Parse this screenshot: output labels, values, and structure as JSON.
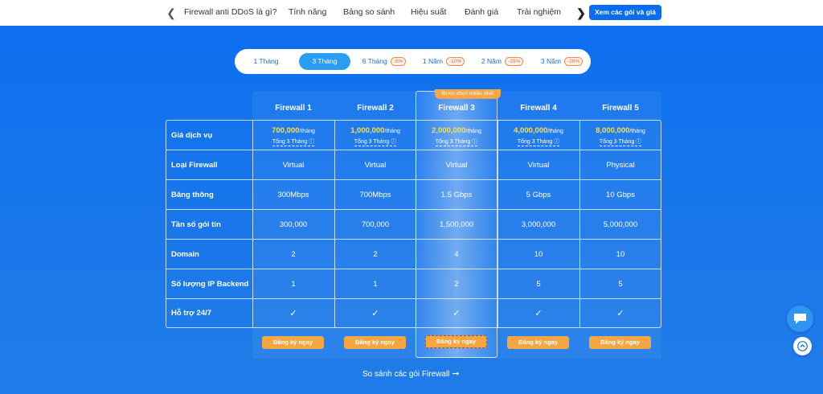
{
  "nav": {
    "items": [
      "Firewall anti DDoS là gì?",
      "Tính năng",
      "Bảng so sánh",
      "Hiệu suất",
      "Đánh giá",
      "Trải nghiệm"
    ],
    "cta_label": "Xem các gói và giá",
    "prev_icon": "chevron-left-icon",
    "next_icon": "chevron-right-icon"
  },
  "periods": [
    {
      "label": "1 Tháng",
      "discount": "",
      "active": false
    },
    {
      "label": "3 Tháng",
      "discount": "",
      "active": true
    },
    {
      "label": "6 Tháng",
      "discount": "-5%",
      "active": false
    },
    {
      "label": "1 Năm",
      "discount": "-10%",
      "active": false
    },
    {
      "label": "2 Năm",
      "discount": "-15%",
      "active": false
    },
    {
      "label": "3 Năm",
      "discount": "-20%",
      "active": false
    }
  ],
  "table": {
    "highlight_tag": "Được chọn nhiều nhất",
    "plans": [
      {
        "name": "Firewall 1",
        "price": "700,000",
        "type": "Virtual",
        "bandwidth": "300Mbps",
        "pps": "300,000",
        "domain": "2",
        "backend_ip": "1"
      },
      {
        "name": "Firewall 2",
        "price": "1,000,000",
        "type": "Virtual",
        "bandwidth": "700Mbps",
        "pps": "700,000",
        "domain": "2",
        "backend_ip": "1"
      },
      {
        "name": "Firewall 3",
        "price": "2,000,000",
        "type": "Virtual",
        "bandwidth": "1.5 Gbps",
        "pps": "1,500,000",
        "domain": "4",
        "backend_ip": "2"
      },
      {
        "name": "Firewall 4",
        "price": "4,000,000",
        "type": "Virtual",
        "bandwidth": "5 Gbps",
        "pps": "3,000,000",
        "domain": "10",
        "backend_ip": "5"
      },
      {
        "name": "Firewall 5",
        "price": "8,000,000",
        "type": "Physical",
        "bandwidth": "10 Gbps",
        "pps": "5,000,000",
        "domain": "10",
        "backend_ip": "5"
      }
    ],
    "price_unit": "/tháng",
    "total_label": "Tổng 3 Tháng",
    "info_icon": "info-icon",
    "row_labels": {
      "price": "Giá dịch vụ",
      "type": "Loại Firewall",
      "bandwidth": "Băng thông",
      "pps": "Tần số gói tin",
      "domain": "Domain",
      "backend_ip": "Số lượng IP Backend",
      "support": "Hỗ trợ 24/7"
    },
    "support_icon": "check-icon",
    "button_label": "Đăng ký ngay"
  },
  "compare_link": "So sánh các gói Firewall",
  "colors": {
    "accent": "#0a6cf0",
    "price": "#f9e04b",
    "button": "#f5a542",
    "discount": "#e8662a"
  }
}
